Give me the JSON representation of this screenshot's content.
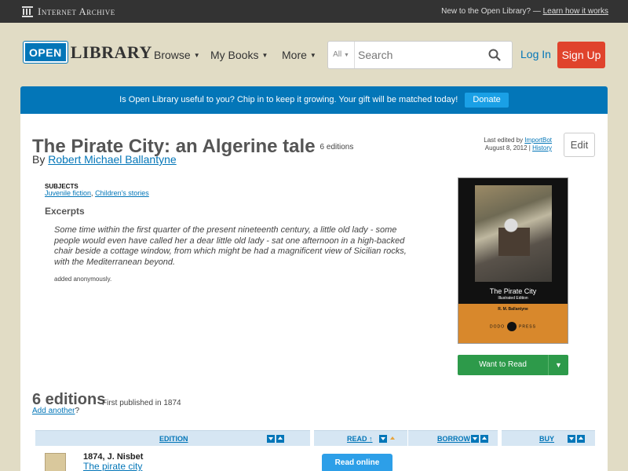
{
  "ia_bar": {
    "brand": "Internet Archive",
    "new_text": "New to the Open Library? —",
    "learn_link": "Learn how it works"
  },
  "header": {
    "logo_open": "OPEN",
    "logo_library": "LIBRARY",
    "nav": [
      {
        "label": "Browse"
      },
      {
        "label": "My Books"
      },
      {
        "label": "More"
      }
    ],
    "search": {
      "scope": "All",
      "placeholder": "Search"
    },
    "login": "Log In",
    "signup": "Sign Up"
  },
  "banner": {
    "text": "Is Open Library useful to you? Chip in to keep it growing. Your gift will be matched today!",
    "donate": "Donate"
  },
  "work": {
    "title": "The Pirate City: an Algerine tale",
    "editions_count": "6 editions",
    "by": "By",
    "author": "Robert Michael Ballantyne",
    "last_edited_prefix": "Last edited by",
    "last_edited_user": "ImportBot",
    "last_edited_date": "August 8, 2012 |",
    "history": "History",
    "edit": "Edit",
    "subjects_heading": "SUBJECTS",
    "subjects": [
      "Juvenile fiction",
      "Children's stories"
    ],
    "excerpts_heading": "Excerpts",
    "excerpt": "Some time within the first quarter of the present nineteenth century, a little old lady - some people would even have called her a dear little old lady - sat one afternoon in a high-backed chair beside a cottage window, from which might be had a magnificent view of Sicilian rocks, with the Mediterranean beyond.",
    "added_by": "added anonymously."
  },
  "cover": {
    "title": "The Pirate City",
    "subtitle": "Illustrated Edition",
    "author": "R. M. Ballantyne",
    "press_left": "DODO",
    "press_right": "PRESS"
  },
  "want_to_read": "Want to Read",
  "editions": {
    "heading": "6 editions",
    "first_published": "First published in 1874",
    "add_link": "Add another",
    "add_suffix": "?",
    "columns": [
      "EDITION",
      "READ",
      "BORROW",
      "BUY"
    ],
    "read_arrow": "↑",
    "rows": [
      {
        "year_publisher": "1874, J. Nisbet",
        "title": "The pirate city",
        "action": "Read online"
      }
    ]
  }
}
